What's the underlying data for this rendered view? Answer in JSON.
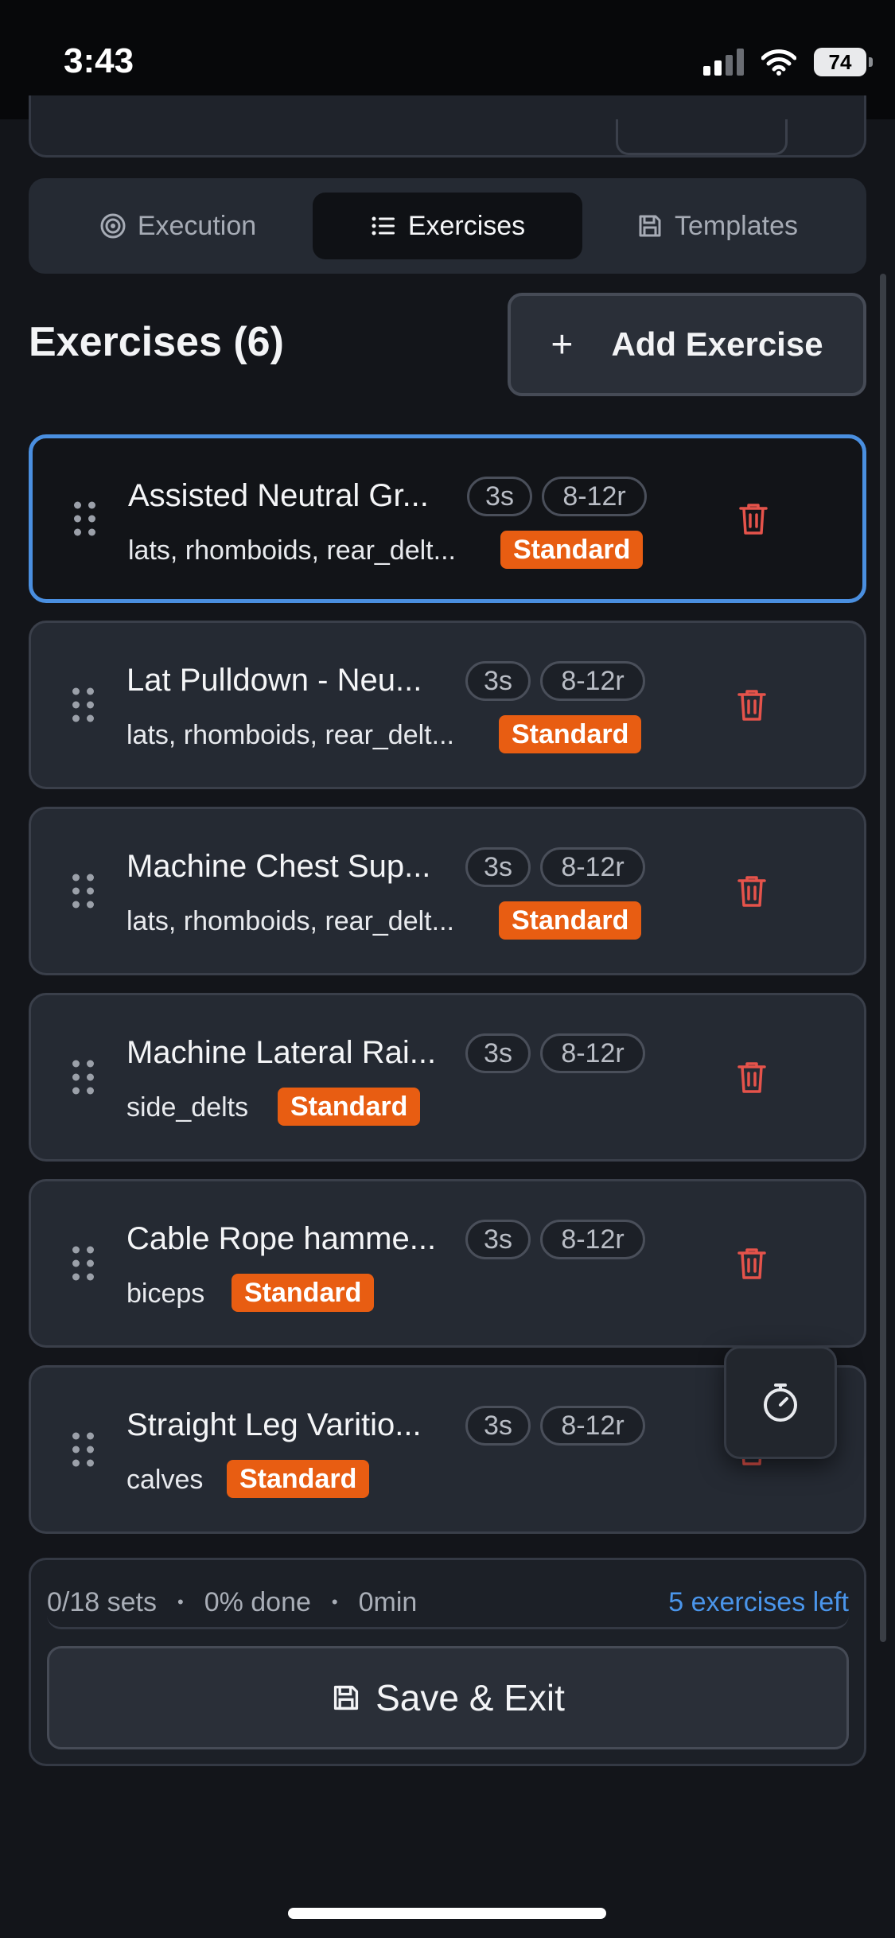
{
  "status": {
    "time": "3:43",
    "battery": "74"
  },
  "tabs": [
    {
      "label": "Execution",
      "icon": "target-icon"
    },
    {
      "label": "Exercises",
      "icon": "list-icon",
      "active": true
    },
    {
      "label": "Templates",
      "icon": "save-icon"
    }
  ],
  "section": {
    "title": "Exercises (6)",
    "add_label": "Add Exercise",
    "add_icon": "+"
  },
  "exercises": [
    {
      "name": "Assisted Neutral Gr...",
      "rest": "3s",
      "reps": "8-12r",
      "muscles": "lats, rhomboids, rear_delt...",
      "type": "Standard",
      "selected": true
    },
    {
      "name": "Lat Pulldown - Neu...",
      "rest": "3s",
      "reps": "8-12r",
      "muscles": "lats, rhomboids, rear_delt...",
      "type": "Standard"
    },
    {
      "name": "Machine Chest Sup...",
      "rest": "3s",
      "reps": "8-12r",
      "muscles": "lats, rhomboids, rear_delt...",
      "type": "Standard"
    },
    {
      "name": "Machine Lateral Rai...",
      "rest": "3s",
      "reps": "8-12r",
      "muscles": "side_delts",
      "type": "Standard"
    },
    {
      "name": "Cable Rope hamme...",
      "rest": "3s",
      "reps": "8-12r",
      "muscles": "biceps",
      "type": "Standard"
    },
    {
      "name": "Straight Leg Varitio...",
      "rest": "3s",
      "reps": "8-12r",
      "muscles": "calves",
      "type": "Standard"
    }
  ],
  "footer": {
    "sets": "0/18 sets",
    "done": "0% done",
    "time": "0min",
    "separator": "•",
    "left": "5 exercises left",
    "save_label": "Save & Exit"
  },
  "colors": {
    "accent": "#4a8fe0",
    "badge": "#e85d12",
    "danger": "#e5534b",
    "link": "#4a95ea"
  }
}
